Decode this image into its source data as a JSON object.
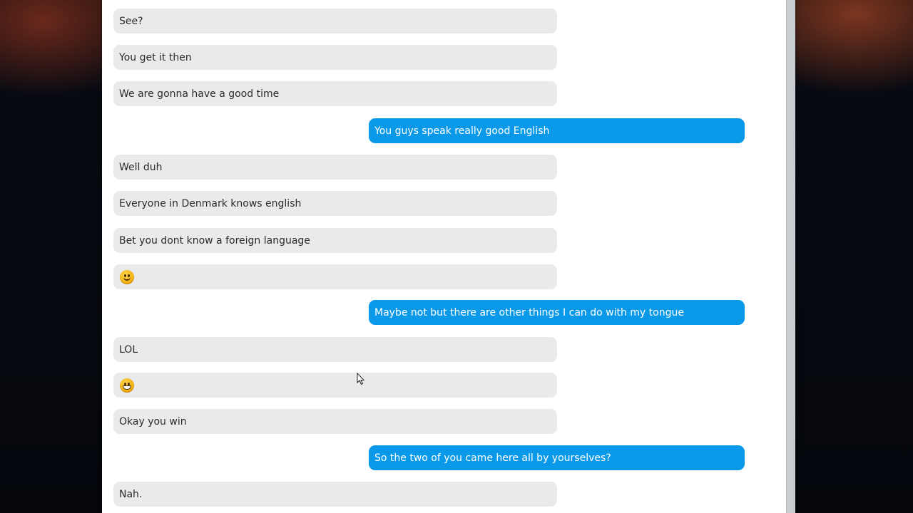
{
  "conversation": {
    "messages": [
      {
        "direction": "incoming",
        "text": "See?"
      },
      {
        "direction": "incoming",
        "text": "You get it then"
      },
      {
        "direction": "incoming",
        "text": "We are gonna have a good time"
      },
      {
        "direction": "outgoing",
        "text": "You guys speak really good English"
      },
      {
        "direction": "incoming",
        "text": "Well duh"
      },
      {
        "direction": "incoming",
        "text": "Everyone in Denmark knows english"
      },
      {
        "direction": "incoming",
        "text": "Bet you dont know a foreign language"
      },
      {
        "direction": "incoming",
        "emoji": "smiling-face-emoji"
      },
      {
        "direction": "outgoing",
        "text": "Maybe not but there are other things I can do with my tongue"
      },
      {
        "direction": "incoming",
        "text": "LOL"
      },
      {
        "direction": "incoming",
        "emoji": "grinning-face-emoji"
      },
      {
        "direction": "incoming",
        "text": "Okay you win"
      },
      {
        "direction": "outgoing",
        "text": "So the two of you came here all by yourselves?"
      },
      {
        "direction": "incoming",
        "text": "Nah."
      }
    ]
  },
  "colors": {
    "incoming_bubble": "#e9eaeb",
    "outgoing_bubble": "#0a98e8",
    "incoming_text": "#2b2b2b",
    "outgoing_text": "#ffffff"
  },
  "icons": {
    "cursor": "mouse-pointer-icon"
  }
}
